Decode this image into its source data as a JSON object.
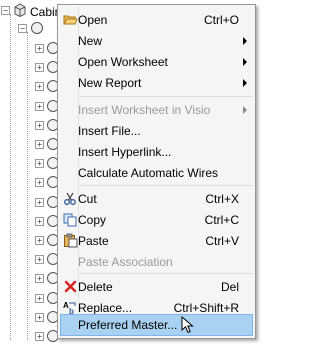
{
  "tree": {
    "root_label": "Cabinet"
  },
  "menu": {
    "items": [
      {
        "label": "Open",
        "shortcut": "Ctrl+O",
        "icon": "open-folder-icon"
      },
      {
        "label": "New",
        "shortcut": "",
        "icon": ""
      },
      {
        "label": "Open Worksheet",
        "shortcut": "",
        "icon": ""
      },
      {
        "label": "New Report",
        "shortcut": "",
        "icon": ""
      },
      {
        "label": "Insert Worksheet in Visio",
        "shortcut": "",
        "icon": "",
        "disabled": true
      },
      {
        "label": "Insert File...",
        "shortcut": "",
        "icon": ""
      },
      {
        "label": "Insert Hyperlink...",
        "shortcut": "",
        "icon": ""
      },
      {
        "label": "Calculate Automatic Wires",
        "shortcut": "",
        "icon": ""
      },
      {
        "label": "Cut",
        "shortcut": "Ctrl+X",
        "icon": "scissors-icon"
      },
      {
        "label": "Copy",
        "shortcut": "Ctrl+C",
        "icon": "copy-icon"
      },
      {
        "label": "Paste",
        "shortcut": "Ctrl+V",
        "icon": "paste-icon"
      },
      {
        "label": "Paste Association",
        "shortcut": "",
        "icon": "",
        "disabled": true
      },
      {
        "label": "Delete",
        "shortcut": "Del",
        "icon": "delete-x-icon"
      },
      {
        "label": "Replace...",
        "shortcut": "Ctrl+Shift+R",
        "icon": "replace-icon"
      },
      {
        "label": "Preferred Master...",
        "shortcut": "",
        "icon": "",
        "highlighted": true
      }
    ]
  },
  "colors": {
    "menu_background": "#f5f5f5",
    "highlight": "#a8d1f2",
    "delete_icon": "#d9201b"
  }
}
